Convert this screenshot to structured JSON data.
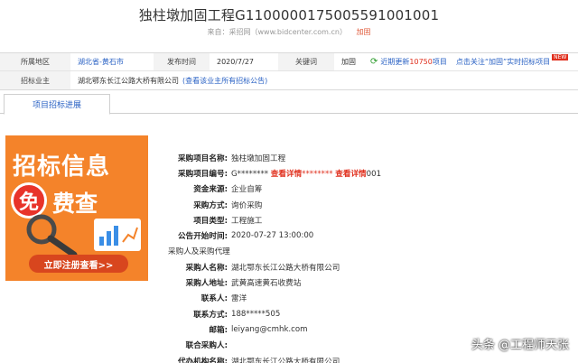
{
  "page": {
    "title": "独柱墩加固工程G1100000175005591001001",
    "source_prefix": "来自：采招网（www.bidcenter.com.cn）",
    "favorite": "加固"
  },
  "info": {
    "region_label": "所属地区",
    "region_value": "湖北省-黄石市",
    "publish_label": "发布时间",
    "publish_value": "2020/7/27",
    "keyword_label": "关键词",
    "keyword_value": "加固",
    "recent_prefix": "近期更新",
    "recent_count": "10750",
    "recent_suffix": "项目",
    "subscribe_text": "点击关注“加固”实时招标项目",
    "new_badge": "NEW",
    "owner_label": "招标业主",
    "owner_value": "湖北鄂东长江公路大桥有限公司",
    "owner_link": "(查看该业主所有招标公告)"
  },
  "tabs": {
    "active": "项目招标进展"
  },
  "banner": {
    "title": "招标信息",
    "mian": "免",
    "rest": "费查",
    "cta": "立即注册查看>>"
  },
  "details": {
    "name_label": "采购项目名称:",
    "name_value": "独柱墩加固工程",
    "code_label": "采购项目编号:",
    "code_p1": "G********",
    "code_link1": "查看详情",
    "code_p2": "********",
    "code_link2": "查看详情",
    "code_p3": "001",
    "fund_label": "资金来源:",
    "fund_value": "企业自筹",
    "method_label": "采购方式:",
    "method_value": "询价采购",
    "type_label": "项目类型:",
    "type_value": "工程施工",
    "start_label": "公告开始时间:",
    "start_value": "2020-07-27 13:00:00",
    "section_title": "采购人及采购代理",
    "buyer_label": "采购人名称:",
    "buyer_value": "湖北鄂东长江公路大桥有限公司",
    "addr_label": "采购人地址:",
    "addr_value": "武黄高速黄石收费站",
    "contact_label": "联系人:",
    "contact_value": "雷洋",
    "phone_label": "联系方式:",
    "phone_value": "188*****505",
    "email_label": "邮箱:",
    "email_value": "leiyang@cmhk.com",
    "joint_label": "联合采购人:",
    "joint_value": "",
    "agent_label": "代办机构名称:",
    "agent_value": "湖北鄂东长江公路大桥有限公司"
  },
  "watermark": "头条 @工程师天张"
}
